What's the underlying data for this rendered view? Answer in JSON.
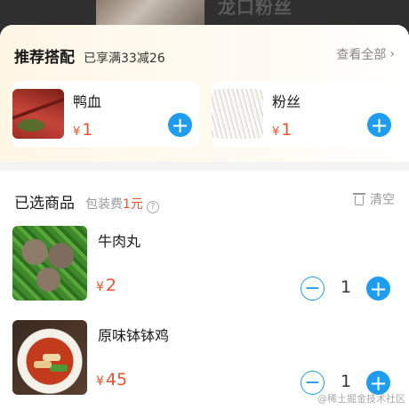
{
  "store": {
    "name": "龙口粉丝"
  },
  "recommend": {
    "title": "推荐搭配",
    "discount": "已享满33减26",
    "view_all": "查看全部",
    "items": [
      {
        "name": "鸭血",
        "currency": "¥",
        "price": "1",
        "add_icon": "plus-icon"
      },
      {
        "name": "粉丝",
        "currency": "¥",
        "price": "1",
        "add_icon": "plus-icon"
      }
    ]
  },
  "selected": {
    "title": "已选商品",
    "pack_fee_label": "包装费",
    "pack_fee_amount": "1元",
    "info_icon": "?",
    "clear_label": "清空",
    "items": [
      {
        "name": "牛肉丸",
        "currency": "¥",
        "price": "2",
        "qty": "1"
      },
      {
        "name": "原味钵钵鸡",
        "currency": "¥",
        "price": "45",
        "qty": "1"
      }
    ]
  },
  "stepper": {
    "minus": "−",
    "plus": "+"
  },
  "watermark": "@稀土掘金技术社区",
  "colors": {
    "accent": "#1d9cf0",
    "price": "#f0522b",
    "header_bg": "#fff6e6"
  }
}
